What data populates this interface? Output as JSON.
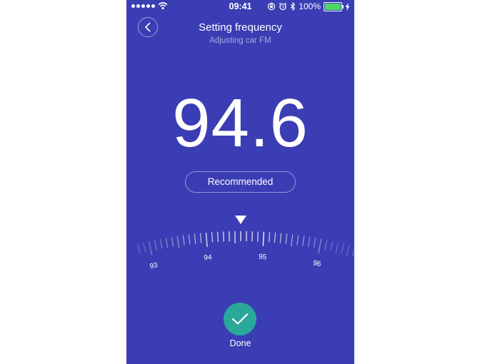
{
  "status_bar": {
    "time": "09:41",
    "battery_percent": "100%",
    "battery_level": 1.0
  },
  "header": {
    "title": "Setting frequency",
    "subtitle": "Adjusting car FM"
  },
  "frequency": {
    "value": "94.6"
  },
  "recommended_button": {
    "label": "Recommended"
  },
  "dial": {
    "min": 92.8,
    "max": 96.6,
    "step": 0.1,
    "current": 94.6,
    "labels": [
      "93",
      "94",
      "95",
      "96"
    ]
  },
  "done": {
    "label": "Done"
  },
  "colors": {
    "background": "#3a3db3",
    "done_button": "#2aa89a",
    "battery": "#4cd964"
  }
}
